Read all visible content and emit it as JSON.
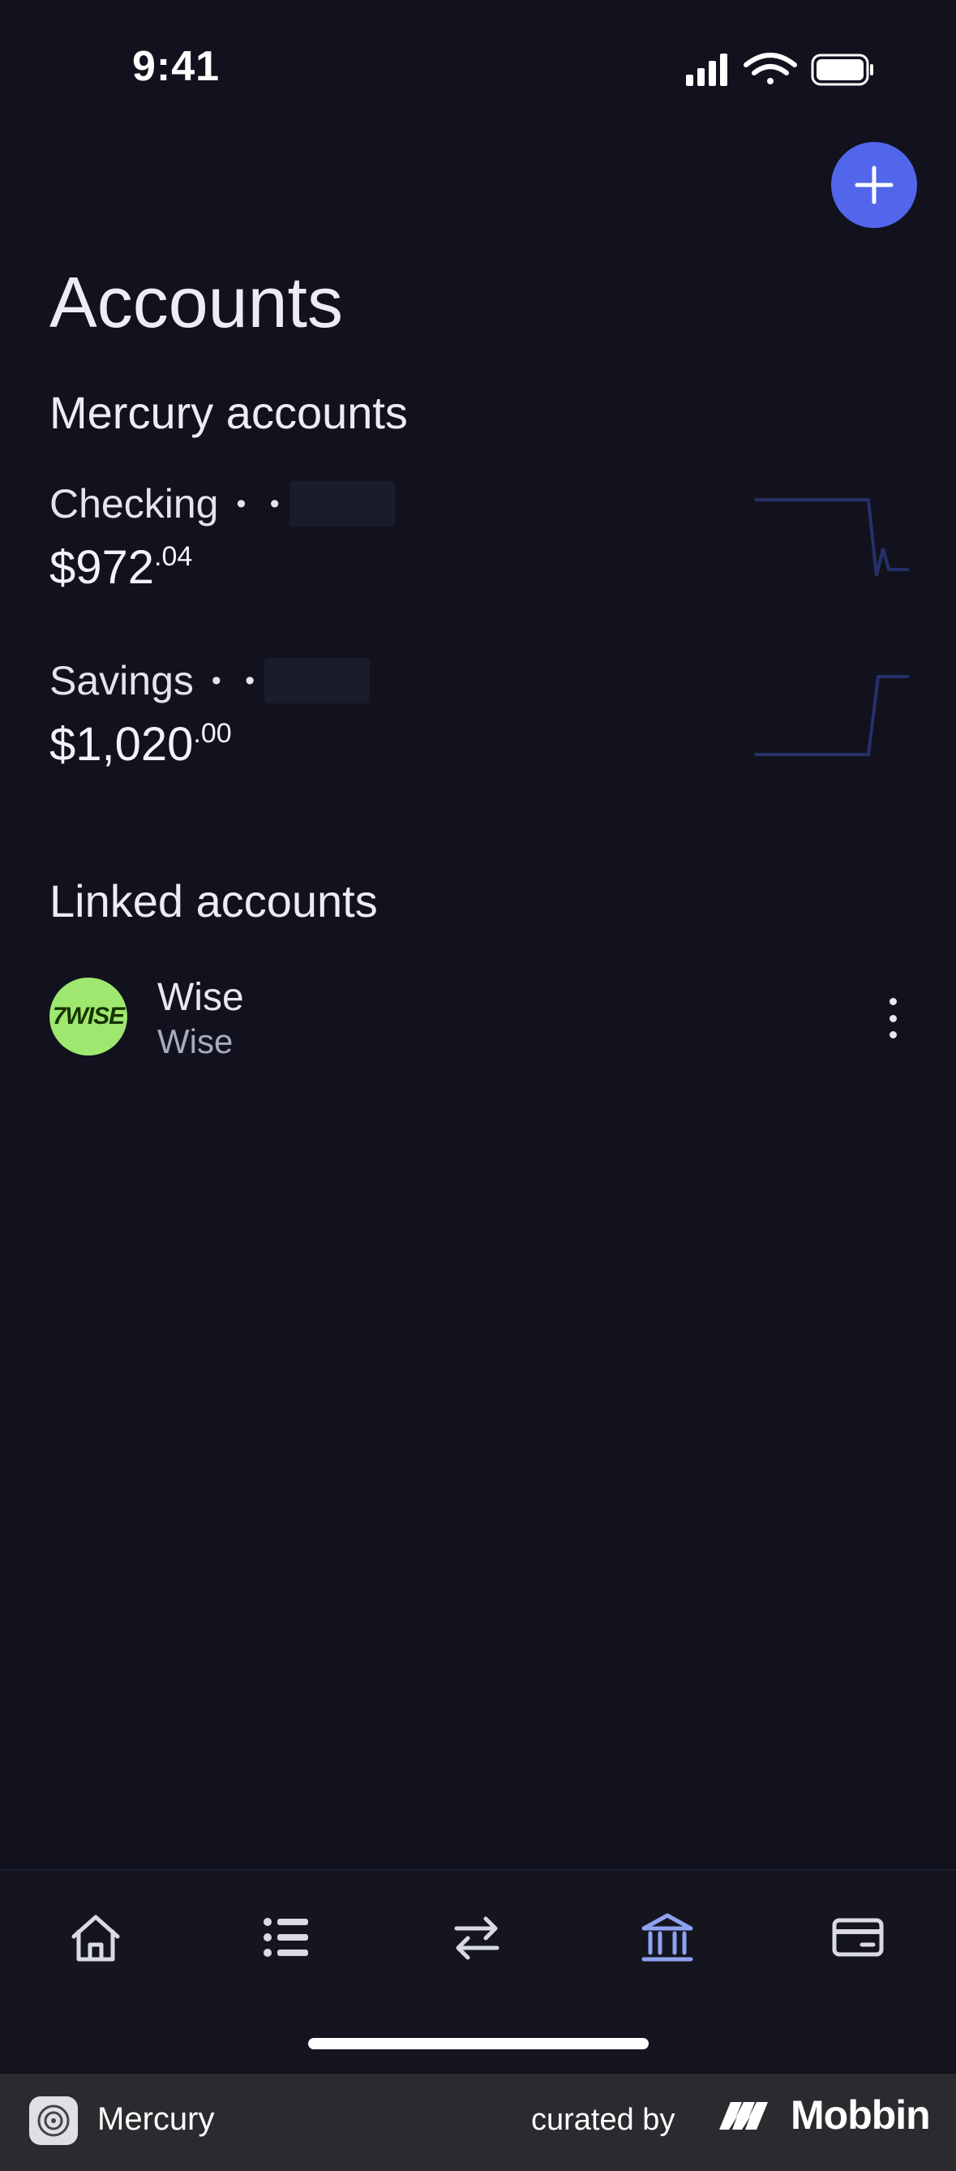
{
  "status_bar": {
    "time": "9:41"
  },
  "page": {
    "title": "Accounts"
  },
  "mercury_section": {
    "title": "Mercury accounts",
    "accounts": [
      {
        "name": "Checking",
        "mask": "• •",
        "balance_main": "$972",
        "balance_cents": ".04"
      },
      {
        "name": "Savings",
        "mask": "• •",
        "balance_main": "$1,020",
        "balance_cents": ".00"
      }
    ]
  },
  "linked_section": {
    "title": "Linked accounts",
    "items": [
      {
        "logo_text": "7WISE",
        "name": "Wise",
        "subtitle": "Wise"
      }
    ]
  },
  "tab_bar": {
    "tabs": [
      {
        "icon": "home-icon",
        "active": false
      },
      {
        "icon": "list-icon",
        "active": false
      },
      {
        "icon": "transfer-icon",
        "active": false
      },
      {
        "icon": "bank-icon",
        "active": true
      },
      {
        "icon": "card-icon",
        "active": false
      }
    ]
  },
  "footer": {
    "app_name": "Mercury",
    "curated_by": "curated by",
    "brand": "Mobbin"
  },
  "colors": {
    "background": "#11121e",
    "accent": "#5266eb",
    "active_tab": "#8fa2f0",
    "wise_green": "#9fe870"
  }
}
